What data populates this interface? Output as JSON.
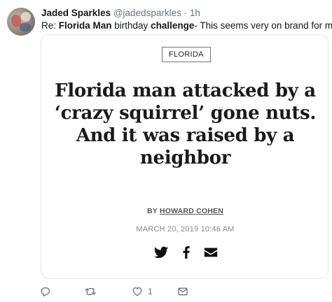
{
  "tweet": {
    "author_name": "Jaded Sparkles",
    "author_handle": "@jadedsparkles",
    "separator": "·",
    "time": "1h",
    "reply_prefix": "Re: ",
    "reply_bold1": "Florida Man",
    "reply_mid": " birthday ",
    "reply_bold2": "challenge",
    "reply_suffix": "- This seems very on brand for me."
  },
  "card": {
    "section_tag": "FLORIDA",
    "headline": "Florida man attacked by a ‘crazy squirrel’ gone nuts. And it was raised by a neighbor",
    "byline_prefix": "BY ",
    "byline_author": "HOWARD COHEN",
    "date": "MARCH 20, 2019 10:46 AM",
    "share_icons": [
      "twitter-icon",
      "facebook-icon",
      "email-icon"
    ]
  },
  "actions": {
    "reply_count": "",
    "retweet_count": "",
    "like_count": "1",
    "dm_count": ""
  },
  "colors": {
    "muted": "#657786",
    "text": "#14171a",
    "border": "#e1e8ed"
  }
}
